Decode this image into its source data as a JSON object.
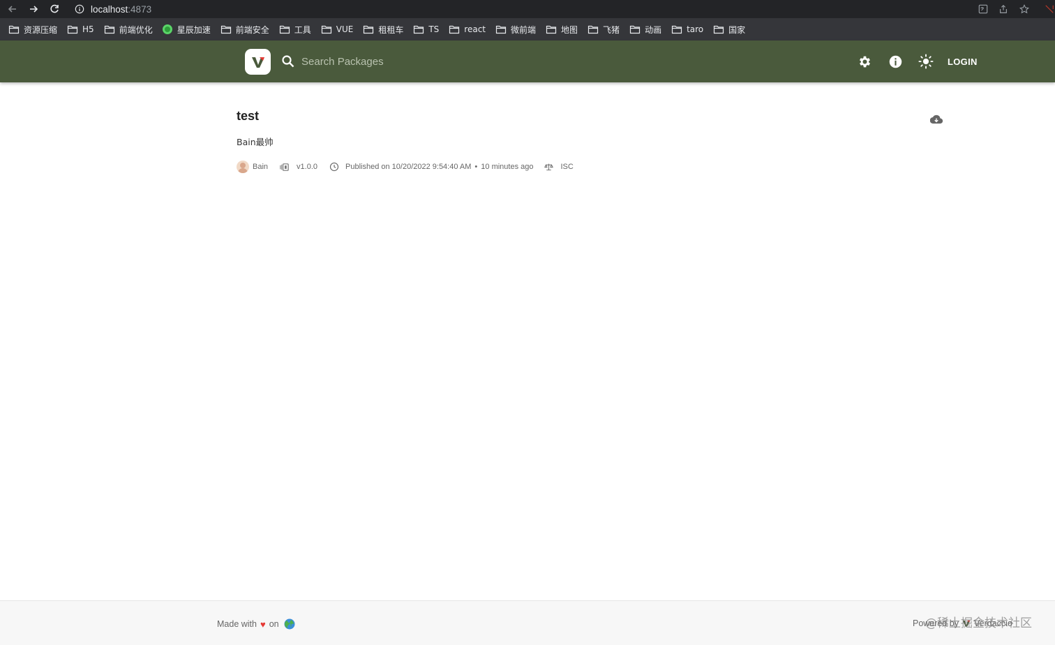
{
  "browser": {
    "url_host": "localhost",
    "url_port": ":4873",
    "bookmarks": [
      {
        "label": "资源压缩",
        "icon": "folder-icon"
      },
      {
        "label": "H5",
        "icon": "folder-icon"
      },
      {
        "label": "前端优化",
        "icon": "folder-icon"
      },
      {
        "label": "星辰加速",
        "icon": "green-circle-icon"
      },
      {
        "label": "前端安全",
        "icon": "folder-icon"
      },
      {
        "label": "工具",
        "icon": "folder-icon"
      },
      {
        "label": "VUE",
        "icon": "folder-icon"
      },
      {
        "label": "租租车",
        "icon": "folder-icon"
      },
      {
        "label": "TS",
        "icon": "folder-icon"
      },
      {
        "label": "react",
        "icon": "folder-icon"
      },
      {
        "label": "微前端",
        "icon": "folder-icon"
      },
      {
        "label": "地图",
        "icon": "folder-icon"
      },
      {
        "label": "飞猪",
        "icon": "folder-icon"
      },
      {
        "label": "动画",
        "icon": "folder-icon"
      },
      {
        "label": "taro",
        "icon": "folder-icon"
      },
      {
        "label": "国家",
        "icon": "folder-icon"
      }
    ]
  },
  "header": {
    "logo_letter": "V",
    "search_placeholder": "Search Packages",
    "login_label": "LOGIN",
    "colors": {
      "header_bg": "#4a5a3c",
      "logo_accent": "#e53935"
    }
  },
  "package": {
    "name": "test",
    "description": "Bain最帅",
    "author": "Bain",
    "version": "v1.0.0",
    "published": "Published on 10/20/2022 9:54:40 AM",
    "separator": "•",
    "relative_time": "10 minutes ago",
    "license": "ISC"
  },
  "footer": {
    "made_with": "Made with",
    "heart": "♥",
    "on": "on",
    "powered_by": "Powered by",
    "powered_name": "Verdaccio",
    "watermark": "@稀土掘金技术社区"
  }
}
